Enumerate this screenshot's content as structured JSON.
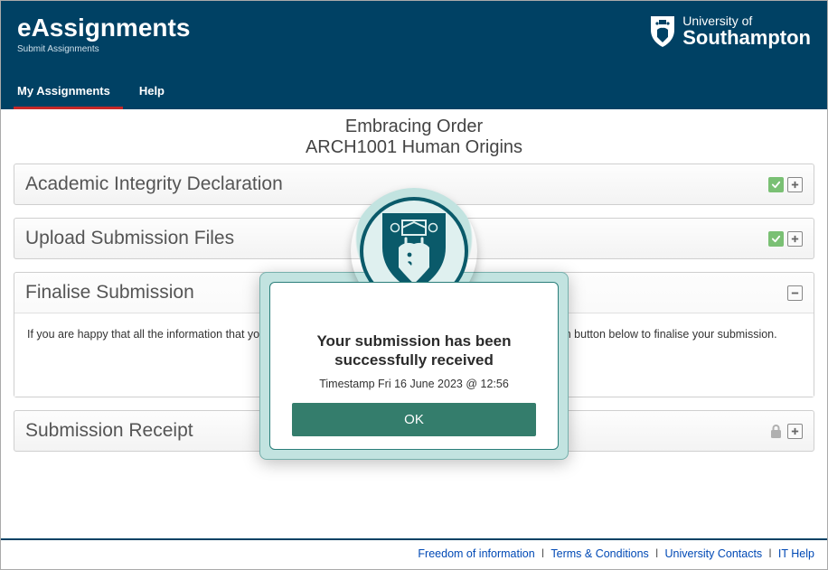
{
  "header": {
    "app_title": "eAssignments",
    "app_subtitle": "Submit Assignments",
    "logo": {
      "line1": "University of",
      "line2": "Southampton"
    }
  },
  "nav": {
    "items": [
      {
        "label": "My Assignments",
        "active": true
      },
      {
        "label": "Help",
        "active": false
      }
    ]
  },
  "assignment": {
    "title": "Embracing Order",
    "course": "ARCH1001 Human Origins"
  },
  "panels": {
    "integrity": {
      "title": "Academic Integrity Declaration"
    },
    "upload": {
      "title": "Upload Submission Files"
    },
    "finalise": {
      "title": "Finalise Submission",
      "body": "If you are happy that all the information that you have entered is correct, please click the Finalise Submission button below to finalise your submission."
    },
    "receipt": {
      "title": "Submission Receipt"
    }
  },
  "modal": {
    "title": "Your submission has been successfully received",
    "timestamp": "Timestamp Fri 16 June 2023 @ 12:56",
    "button": "OK"
  },
  "footer": {
    "links": [
      "Freedom of information",
      "Terms & Conditions",
      "University Contacts",
      "IT Help"
    ]
  }
}
